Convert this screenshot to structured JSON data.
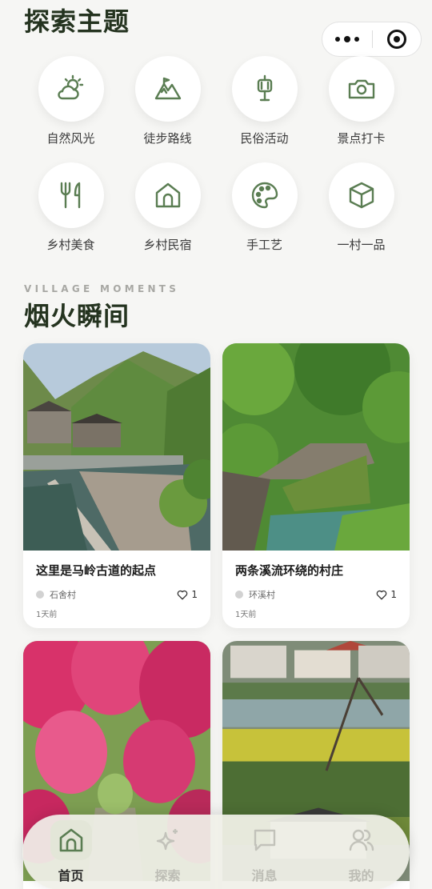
{
  "header": {
    "title": "探索主题"
  },
  "capsule": {
    "more_icon": "more-dots-icon",
    "close_icon": "record-icon"
  },
  "categories": [
    {
      "label": "自然风光",
      "icon": "sun-cloud-icon"
    },
    {
      "label": "徒步路线",
      "icon": "mountain-icon"
    },
    {
      "label": "民俗活动",
      "icon": "lantern-icon"
    },
    {
      "label": "景点打卡",
      "icon": "camera-icon"
    },
    {
      "label": "乡村美食",
      "icon": "fork-knife-icon"
    },
    {
      "label": "乡村民宿",
      "icon": "house-icon"
    },
    {
      "label": "手工艺",
      "icon": "palette-icon"
    },
    {
      "label": "一村一品",
      "icon": "cube-icon"
    }
  ],
  "moments": {
    "subtitle": "VILLAGE MOMENTS",
    "title": "烟火瞬间",
    "cards": [
      {
        "title": "这里是马岭古道的起点",
        "village": "石舍村",
        "likes": "1",
        "time": "1天前"
      },
      {
        "title": "两条溪流环绕的村庄",
        "village": "环溪村",
        "likes": "1",
        "time": "1天前"
      },
      {
        "title": "",
        "village": "",
        "likes": "",
        "time": ""
      },
      {
        "title": "",
        "village": "",
        "likes": "",
        "time": ""
      }
    ]
  },
  "tabbar": {
    "items": [
      {
        "label": "首页",
        "icon": "home-icon",
        "active": true
      },
      {
        "label": "探索",
        "icon": "sparkle-icon",
        "active": false
      },
      {
        "label": "消息",
        "icon": "chat-bubble-icon",
        "active": false
      },
      {
        "label": "我的",
        "icon": "users-icon",
        "active": false
      }
    ]
  },
  "colors": {
    "accent": "#5a7d52",
    "title": "#24331f",
    "background": "#f6f6f4"
  }
}
